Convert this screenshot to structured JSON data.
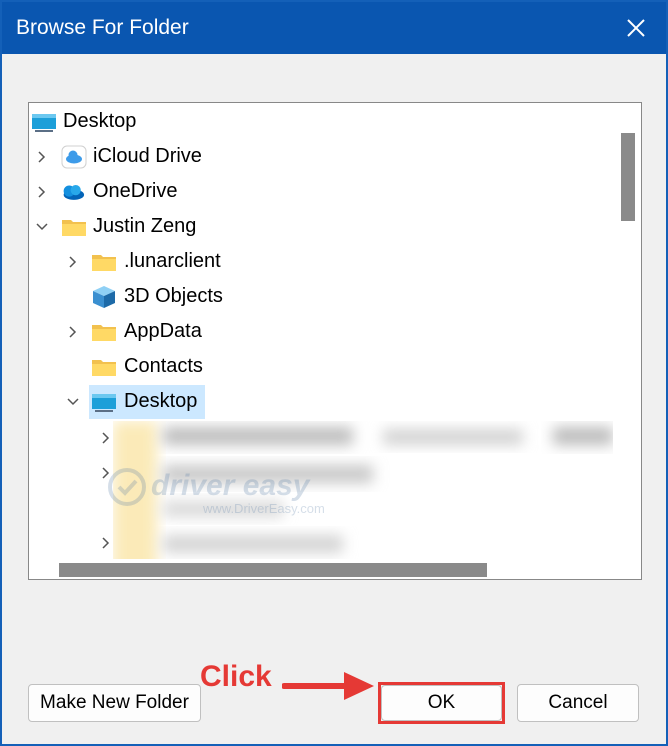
{
  "window": {
    "title": "Browse For Folder"
  },
  "tree": {
    "items": [
      {
        "label": "Desktop",
        "icon": "desktop-icon",
        "expander": "none"
      },
      {
        "label": "iCloud Drive",
        "icon": "icloud-icon",
        "expander": "collapsed"
      },
      {
        "label": "OneDrive",
        "icon": "onedrive-icon",
        "expander": "collapsed"
      },
      {
        "label": "Justin Zeng",
        "icon": "folder-icon",
        "expander": "expanded"
      },
      {
        "label": ".lunarclient",
        "icon": "folder-icon",
        "expander": "collapsed"
      },
      {
        "label": "3D Objects",
        "icon": "3d-objects-icon",
        "expander": "none"
      },
      {
        "label": "AppData",
        "icon": "folder-icon",
        "expander": "collapsed"
      },
      {
        "label": "Contacts",
        "icon": "folder-icon",
        "expander": "none"
      },
      {
        "label": "Desktop",
        "icon": "desktop-icon",
        "expander": "expanded",
        "selected": true
      }
    ]
  },
  "buttons": {
    "make_new_folder": "Make New Folder",
    "ok": "OK",
    "cancel": "Cancel"
  },
  "annotation": {
    "text": "Click"
  },
  "watermark": {
    "brand": "driver easy",
    "url": "www.DriverEasy.com"
  },
  "colors": {
    "titlebar": "#0a56b0",
    "selection": "#cce8ff",
    "annotation": "#e53935"
  }
}
